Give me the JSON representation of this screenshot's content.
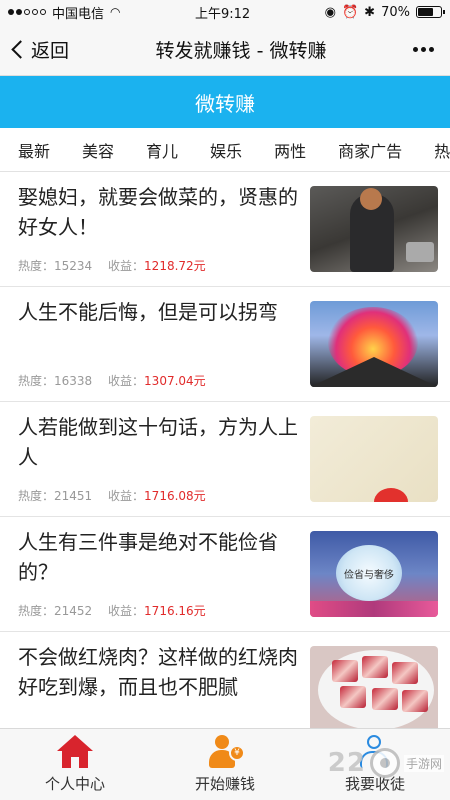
{
  "status": {
    "carrier": "中国电信",
    "time": "上午9:12",
    "battery": "70%",
    "battery_level": 0.7
  },
  "nav": {
    "back_label": "返回",
    "title": "转发就赚钱 - 微转赚"
  },
  "banner": {
    "title": "微转赚",
    "color": "#1bb2ef"
  },
  "categories": [
    "最新",
    "美容",
    "育儿",
    "娱乐",
    "两性",
    "商家广告",
    "热"
  ],
  "meta_labels": {
    "heat": "热度：",
    "earn": "收益：",
    "unit": "元"
  },
  "articles": [
    {
      "title": "娶媳妇，就要会做菜的，贤惠的好女人！",
      "heat": "15234",
      "earn": "1218.72"
    },
    {
      "title": "人生不能后悔，但是可以拐弯",
      "heat": "16338",
      "earn": "1307.04"
    },
    {
      "title": "人若能做到这十句话，方为人上人",
      "heat": "21451",
      "earn": "1716.08"
    },
    {
      "title": "人生有三件事是绝对不能俭省的？",
      "heat": "21452",
      "earn": "1716.16"
    },
    {
      "title": "不会做红烧肉？这样做的红烧肉好吃到爆，而且也不肥腻",
      "heat": "",
      "earn": ""
    }
  ],
  "thumb4_text": "俭省与奢侈",
  "tabbar": {
    "personal": "个人中心",
    "start": "开始赚钱",
    "collect": "我要收徒"
  },
  "watermark": {
    "number": "22",
    "text": "手游网"
  }
}
